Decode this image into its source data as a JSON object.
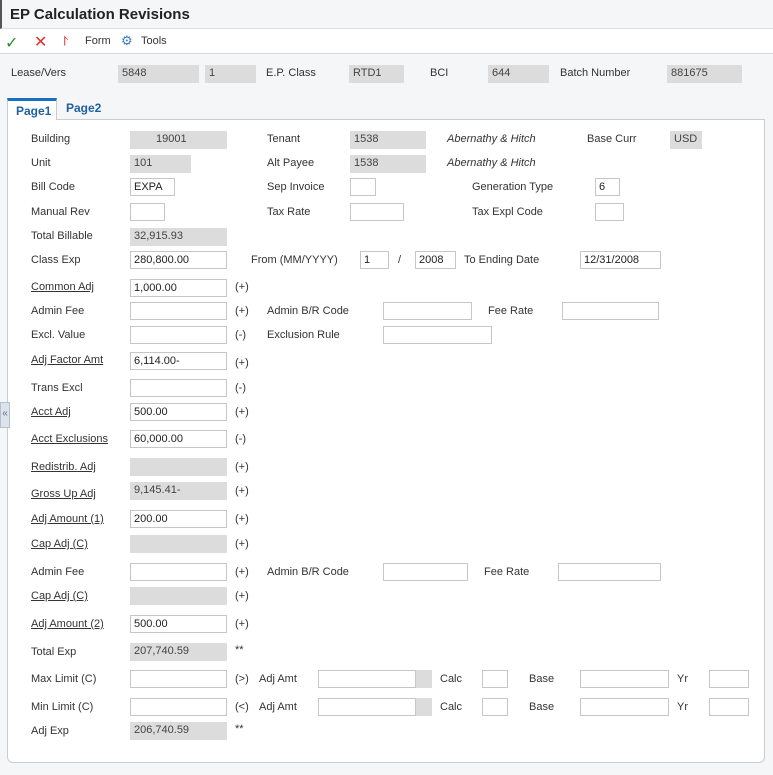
{
  "title": "EP Calculation Revisions",
  "toolbar": {
    "ok": "OK",
    "cancel": "Cancel",
    "form": "Form",
    "tools": "Tools"
  },
  "header": {
    "lease_label": "Lease/Vers",
    "lease": "5848",
    "version": "1",
    "epclass_label": "E.P. Class",
    "epclass": "RTD1",
    "bci_label": "BCI",
    "bci": "644",
    "batch_label": "Batch Number",
    "batch": "881675"
  },
  "tabs": [
    "Page1",
    "Page2"
  ],
  "form": {
    "building_label": "Building",
    "building": "19001",
    "tenant_label": "Tenant",
    "tenant": "1538",
    "tenant_name": "Abernathy & Hitch",
    "basecurr_label": "Base Curr",
    "basecurr": "USD",
    "unit_label": "Unit",
    "unit": "101",
    "altpayee_label": "Alt Payee",
    "altpayee": "1538",
    "altpayee_name": "Abernathy & Hitch",
    "billcode_label": "Bill Code",
    "billcode": "EXPA",
    "sepinv_label": "Sep Invoice",
    "sepinv": "",
    "gentype_label": "Generation Type",
    "gentype": "6",
    "manualrev_label": "Manual Rev",
    "manualrev": "",
    "taxrate_label": "Tax Rate",
    "taxrate": "",
    "taxexpl_label": "Tax Expl Code",
    "taxexpl": "",
    "totalbill_label": "Total Billable",
    "totalbill": "32,915.93",
    "classexp_label": "Class Exp",
    "classexp": "280,800.00",
    "from_label": "From (MM/YYYY)",
    "from_month": "1",
    "slash": "/",
    "from_year": "2008",
    "to_label": "To Ending Date",
    "to_date": "12/31/2008",
    "commonadj_label": "Common Adj",
    "commonadj": "1,000.00",
    "adminfee_label": "Admin Fee",
    "adminbr_label": "Admin B/R Code",
    "feerate_label": "Fee Rate",
    "exclvalue_label": "Excl. Value",
    "exclrule_label": "Exclusion Rule",
    "adjfactor_label": "Adj Factor Amt",
    "adjfactor": "6,114.00-",
    "transexcl_label": "Trans Excl",
    "acctadj_label": "Acct Adj",
    "acctadj": "500.00",
    "acctexcl_label": "Acct Exclusions",
    "acctexcl": "60,000.00",
    "redistrib_label": "Redistrib. Adj",
    "grossup_label": "Gross Up Adj",
    "grossup": "9,145.41-",
    "adjamt1_label": "Adj Amount (1)",
    "adjamt1": "200.00",
    "capadj_label": "Cap Adj (C)",
    "adminfee2_label": "Admin Fee",
    "adminbr2_label": "Admin B/R Code",
    "feerate2_label": "Fee Rate",
    "capadj2_label": "Cap Adj (C)",
    "adjamt2_label": "Adj Amount (2)",
    "adjamt2": "500.00",
    "totalexp_label": "Total Exp",
    "totalexp": "207,740.59",
    "maxlimit_label": "Max Limit (C)",
    "minlimit_label": "Min Limit (C)",
    "adjamt_label": "Adj Amt",
    "calc_label": "Calc",
    "base_label": "Base",
    "yr_label": "Yr",
    "adjexp_label": "Adj Exp",
    "adjexp": "206,740.59",
    "plus": "(+)",
    "minus": "(-)",
    "gt": "(>)",
    "lt": "(<)",
    "stars": "**"
  }
}
